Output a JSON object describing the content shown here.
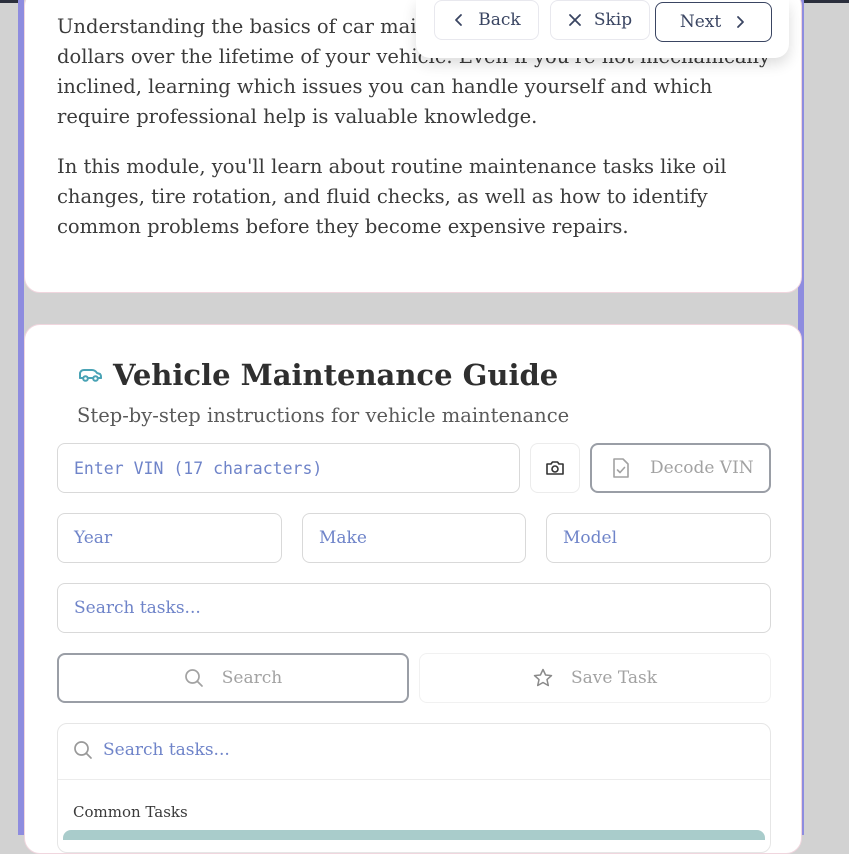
{
  "intro": {
    "paragraph1": "Understanding the basics of car maintenance can save you thousands of dollars over the lifetime of your vehicle. Even if you're not mechanically inclined, learning which issues you can handle yourself and which require professional help is valuable knowledge.",
    "paragraph2": "In this module, you'll learn about routine maintenance tasks like oil changes, tire rotation, and fluid checks, as well as how to identify common problems before they become expensive repairs."
  },
  "tour": {
    "back_label": "Back",
    "skip_label": "Skip",
    "next_label": "Next"
  },
  "guide": {
    "title": "Vehicle Maintenance Guide",
    "subtitle": "Step-by-step instructions for vehicle maintenance",
    "vin_placeholder": "Enter VIN (17 characters)",
    "decode_label": "Decode VIN",
    "year_placeholder": "Year",
    "make_placeholder": "Make",
    "model_placeholder": "Model",
    "search_placeholder": "Search tasks...",
    "search_button_label": "Search",
    "save_button_label": "Save Task",
    "panel_search_placeholder": "Search tasks...",
    "group_label": "Common Tasks"
  },
  "colors": {
    "accent": "#8e8cdf",
    "placeholder": "#6f84c9",
    "highlight": "#a9cccb"
  }
}
